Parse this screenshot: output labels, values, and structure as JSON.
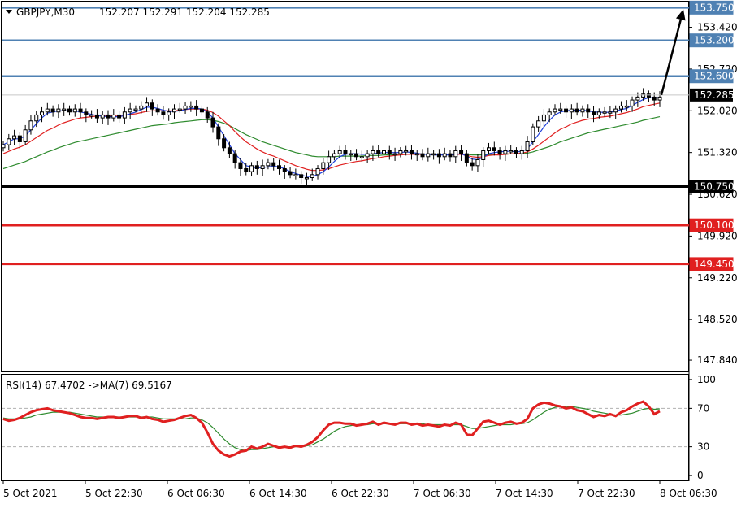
{
  "header": {
    "symbol": "GBPJPY,M30",
    "ohlc": "152.207 152.291 152.204 152.285"
  },
  "rsi_header": "RSI(14) 67.4702  ->MA(7) 69.5167",
  "colors": {
    "resistance": "#4f81b3",
    "support": "#e02020",
    "pivot": "#000000",
    "ma_fast": "#1f3fdc",
    "ma_mid": "#e02020",
    "ma_slow": "#2e8b2e",
    "rsi": "#e02020",
    "rsi_ma": "#2e8b2e",
    "candle_up": "#ffffff",
    "candle_down": "#000000"
  },
  "chart_data": [
    {
      "type": "candlestick",
      "symbol": "GBPJPY",
      "timeframe": "M30",
      "ylim": [
        147.65,
        153.85
      ],
      "y_ticks": [
        "153.420",
        "152.720",
        "152.020",
        "151.320",
        "150.620",
        "149.920",
        "149.220",
        "148.520",
        "147.840"
      ],
      "x_ticks": [
        "5 Oct 2021",
        "5 Oct 22:30",
        "6 Oct 06:30",
        "6 Oct 14:30",
        "6 Oct 22:30",
        "7 Oct 06:30",
        "7 Oct 14:30",
        "7 Oct 22:30",
        "8 Oct 06:30"
      ],
      "current_price": "152.285",
      "current_price_value": 152.285,
      "levels": [
        {
          "label": "153.750",
          "value": 153.75,
          "role": "resistance"
        },
        {
          "label": "153.200",
          "value": 153.2,
          "role": "resistance"
        },
        {
          "label": "152.600",
          "value": 152.6,
          "role": "resistance"
        },
        {
          "label": "150.750",
          "value": 150.75,
          "role": "pivot"
        },
        {
          "label": "150.100",
          "value": 150.1,
          "role": "support"
        },
        {
          "label": "149.450",
          "value": 149.45,
          "role": "support"
        }
      ],
      "close_series": [
        151.45,
        151.55,
        151.6,
        151.5,
        151.7,
        151.85,
        151.95,
        152.0,
        152.05,
        152.0,
        152.05,
        152.05,
        152.0,
        152.05,
        152.0,
        151.95,
        151.95,
        151.9,
        151.95,
        151.9,
        151.95,
        151.9,
        152.0,
        152.05,
        152.05,
        152.1,
        152.15,
        152.05,
        152.0,
        151.95,
        152.0,
        152.05,
        152.05,
        152.1,
        152.1,
        152.05,
        152.0,
        151.9,
        151.75,
        151.55,
        151.4,
        151.3,
        151.15,
        151.05,
        151.0,
        151.1,
        151.05,
        151.1,
        151.15,
        151.1,
        151.05,
        151.0,
        150.95,
        150.95,
        150.9,
        150.9,
        150.95,
        151.05,
        151.15,
        151.25,
        151.3,
        151.35,
        151.3,
        151.3,
        151.25,
        151.25,
        151.3,
        151.35,
        151.3,
        151.35,
        151.3,
        151.3,
        151.35,
        151.35,
        151.3,
        151.3,
        151.25,
        151.3,
        151.3,
        151.25,
        151.3,
        151.25,
        151.35,
        151.3,
        151.15,
        151.1,
        151.2,
        151.35,
        151.4,
        151.35,
        151.3,
        151.35,
        151.35,
        151.3,
        151.35,
        151.5,
        151.75,
        151.85,
        151.95,
        152.0,
        152.05,
        152.05,
        152.0,
        152.05,
        152.0,
        152.05,
        152.0,
        151.95,
        152.0,
        152.0,
        152.0,
        152.05,
        152.1,
        152.1,
        152.2,
        152.25,
        152.3,
        152.25,
        152.2,
        152.25
      ],
      "ma_fast": [
        151.45,
        151.5,
        151.55,
        151.55,
        151.6,
        151.7,
        151.8,
        151.9,
        151.98,
        152.0,
        152.02,
        152.02,
        152.02,
        152.02,
        152.0,
        151.98,
        151.96,
        151.94,
        151.93,
        151.92,
        151.92,
        151.92,
        151.94,
        151.97,
        152.0,
        152.04,
        152.08,
        152.08,
        152.06,
        152.03,
        152.01,
        152.01,
        152.02,
        152.04,
        152.06,
        152.06,
        152.05,
        152.0,
        151.9,
        151.75,
        151.6,
        151.45,
        151.3,
        151.2,
        151.1,
        151.08,
        151.06,
        151.07,
        151.08,
        151.09,
        151.08,
        151.05,
        151.0,
        150.97,
        150.94,
        150.92,
        150.92,
        150.95,
        151.0,
        151.08,
        151.17,
        151.25,
        151.29,
        151.3,
        151.3,
        151.29,
        151.29,
        151.3,
        151.31,
        151.32,
        151.32,
        151.32,
        151.32,
        151.33,
        151.32,
        151.31,
        151.29,
        151.29,
        151.28,
        151.28,
        151.28,
        151.28,
        151.29,
        151.3,
        151.26,
        151.21,
        151.2,
        151.24,
        151.3,
        151.32,
        151.33,
        151.34,
        151.34,
        151.33,
        151.34,
        151.38,
        151.5,
        151.62,
        151.75,
        151.86,
        151.95,
        152.0,
        152.02,
        152.03,
        152.03,
        152.03,
        152.02,
        152.0,
        152.0,
        151.99,
        152.0,
        152.01,
        152.04,
        152.06,
        152.11,
        152.16,
        152.21,
        152.24,
        152.24,
        152.24
      ],
      "ma_mid": [
        151.3,
        151.34,
        151.38,
        151.41,
        151.45,
        151.51,
        151.57,
        151.63,
        151.69,
        151.73,
        151.78,
        151.82,
        151.85,
        151.88,
        151.9,
        151.91,
        151.92,
        151.93,
        151.94,
        151.94,
        151.94,
        151.94,
        151.95,
        151.96,
        151.97,
        151.99,
        152.01,
        152.02,
        152.02,
        152.02,
        152.02,
        152.02,
        152.03,
        152.04,
        152.05,
        152.05,
        152.05,
        152.03,
        151.99,
        151.93,
        151.85,
        151.77,
        151.67,
        151.58,
        151.5,
        151.44,
        151.38,
        151.33,
        151.29,
        151.26,
        151.22,
        151.18,
        151.14,
        151.1,
        151.07,
        151.04,
        151.02,
        151.02,
        151.03,
        151.05,
        151.08,
        151.11,
        151.13,
        151.15,
        151.17,
        151.18,
        151.2,
        151.22,
        151.23,
        151.25,
        151.26,
        151.27,
        151.28,
        151.29,
        151.29,
        151.29,
        151.29,
        151.29,
        151.29,
        151.29,
        151.29,
        151.28,
        151.29,
        151.29,
        151.27,
        151.25,
        151.24,
        151.25,
        151.27,
        151.28,
        151.28,
        151.29,
        151.3,
        151.3,
        151.31,
        151.33,
        151.38,
        151.44,
        151.51,
        151.58,
        151.65,
        151.71,
        151.75,
        151.8,
        151.83,
        151.86,
        151.88,
        151.89,
        151.91,
        151.92,
        151.93,
        151.95,
        151.97,
        151.99,
        152.02,
        152.05,
        152.09,
        152.11,
        152.13,
        152.15
      ],
      "ma_slow": [
        151.05,
        151.08,
        151.11,
        151.14,
        151.17,
        151.21,
        151.25,
        151.29,
        151.33,
        151.36,
        151.4,
        151.43,
        151.46,
        151.49,
        151.51,
        151.53,
        151.55,
        151.57,
        151.59,
        151.61,
        151.63,
        151.65,
        151.67,
        151.69,
        151.71,
        151.73,
        151.75,
        151.77,
        151.78,
        151.79,
        151.8,
        151.82,
        151.83,
        151.84,
        151.85,
        151.86,
        151.87,
        151.87,
        151.86,
        151.84,
        151.81,
        151.77,
        151.72,
        151.67,
        151.62,
        151.58,
        151.54,
        151.5,
        151.47,
        151.44,
        151.41,
        151.38,
        151.35,
        151.32,
        151.3,
        151.28,
        151.26,
        151.25,
        151.25,
        151.25,
        151.25,
        151.26,
        151.26,
        151.26,
        151.26,
        151.26,
        151.27,
        151.27,
        151.27,
        151.28,
        151.28,
        151.28,
        151.29,
        151.29,
        151.29,
        151.29,
        151.29,
        151.29,
        151.29,
        151.29,
        151.29,
        151.29,
        151.29,
        151.29,
        151.29,
        151.28,
        151.28,
        151.28,
        151.28,
        151.29,
        151.29,
        151.29,
        151.3,
        151.3,
        151.3,
        151.31,
        151.33,
        151.36,
        151.39,
        151.42,
        151.46,
        151.5,
        151.53,
        151.56,
        151.59,
        151.62,
        151.65,
        151.67,
        151.69,
        151.71,
        151.73,
        151.75,
        151.77,
        151.79,
        151.81,
        151.83,
        151.86,
        151.88,
        151.9,
        151.92
      ],
      "forecast_arrow": {
        "from": 152.285,
        "to": 153.75
      }
    },
    {
      "type": "line",
      "name": "RSI(14)",
      "ylim": [
        -5,
        105
      ],
      "y_ticks": [
        100,
        70,
        30,
        0
      ],
      "guide_levels": [
        70,
        30
      ],
      "rsi": [
        59,
        57,
        58,
        60,
        63,
        66,
        68,
        69,
        70,
        68,
        67,
        66,
        65,
        63,
        61,
        60,
        60,
        59,
        60,
        61,
        61,
        60,
        61,
        62,
        62,
        60,
        61,
        59,
        58,
        56,
        57,
        58,
        60,
        62,
        63,
        60,
        55,
        45,
        33,
        26,
        22,
        20,
        22,
        25,
        26,
        30,
        28,
        30,
        33,
        31,
        29,
        30,
        29,
        31,
        30,
        32,
        35,
        40,
        47,
        53,
        55,
        55,
        54,
        54,
        52,
        53,
        54,
        56,
        53,
        55,
        54,
        53,
        55,
        55,
        53,
        54,
        52,
        53,
        52,
        51,
        53,
        52,
        55,
        53,
        43,
        42,
        49,
        56,
        57,
        55,
        53,
        55,
        56,
        54,
        55,
        59,
        70,
        74,
        76,
        75,
        73,
        72,
        70,
        71,
        68,
        67,
        64,
        61,
        63,
        62,
        64,
        62,
        66,
        68,
        72,
        75,
        77,
        72,
        64,
        67
      ],
      "rsi_ma": [
        60,
        59,
        59,
        59,
        60,
        61,
        63,
        64,
        65,
        66,
        66,
        66,
        66,
        65,
        64,
        63,
        62,
        61,
        61,
        61,
        61,
        61,
        61,
        61,
        61,
        61,
        61,
        61,
        60,
        59,
        59,
        59,
        59,
        59,
        60,
        60,
        58,
        55,
        50,
        44,
        38,
        33,
        29,
        27,
        26,
        27,
        27,
        28,
        29,
        30,
        30,
        30,
        30,
        30,
        30,
        31,
        32,
        35,
        38,
        42,
        46,
        49,
        51,
        52,
        53,
        53,
        53,
        54,
        54,
        54,
        54,
        54,
        54,
        54,
        54,
        54,
        54,
        53,
        53,
        53,
        53,
        53,
        53,
        53,
        51,
        49,
        49,
        50,
        51,
        52,
        53,
        53,
        53,
        54,
        54,
        55,
        58,
        62,
        66,
        69,
        71,
        72,
        72,
        72,
        71,
        70,
        69,
        67,
        66,
        65,
        64,
        63,
        63,
        64,
        65,
        67,
        69,
        70,
        69,
        69.5
      ]
    }
  ]
}
